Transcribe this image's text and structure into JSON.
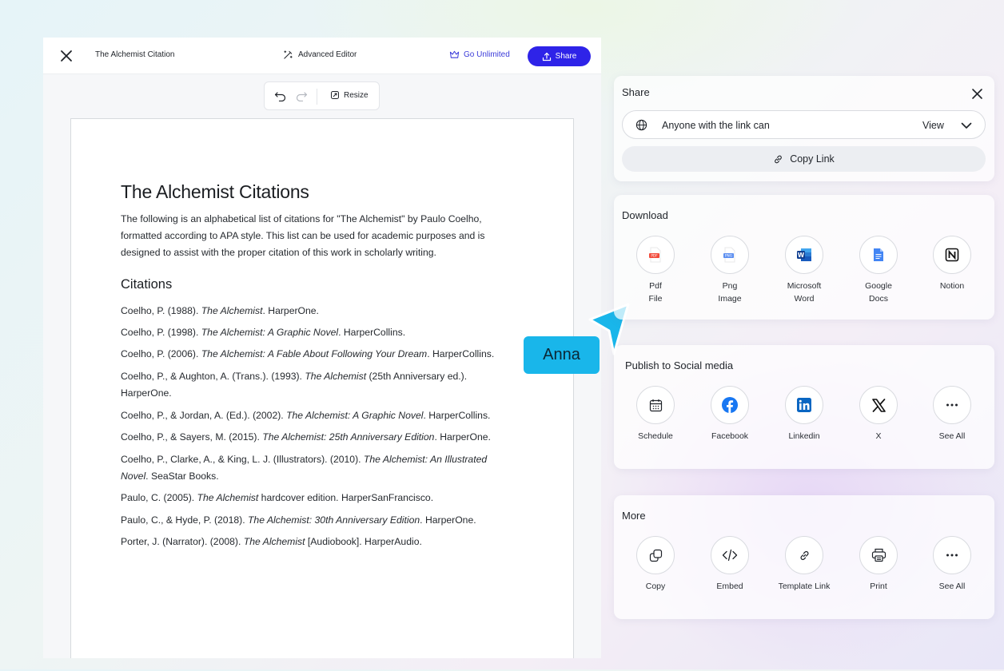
{
  "editor": {
    "doc_title": "The Alchemist Citation",
    "advanced_editor": "Advanced Editor",
    "go_unlimited": "Go Unlimited",
    "share": "Share",
    "resize": "Resize"
  },
  "document": {
    "heading": "The Alchemist Citations",
    "intro_lines": [
      "The following is an alphabetical list of citations for \"The Alchemist\" by Paulo Coelho,",
      "formatted according to APA style. This list can be used for academic purposes and is",
      "designed to assist with the proper citation of this work in scholarly writing."
    ],
    "citations_heading": "Citations",
    "citations": [
      [
        {
          "t": "Coelho, P. (1988). "
        },
        {
          "t": "The Alchemist",
          "i": true
        },
        {
          "t": ". HarperOne."
        }
      ],
      [
        {
          "t": "Coelho, P. (1998). "
        },
        {
          "t": "The Alchemist: A Graphic Novel",
          "i": true
        },
        {
          "t": ". HarperCollins."
        }
      ],
      [
        {
          "t": "Coelho, P. (2006). "
        },
        {
          "t": "The Alchemist: A Fable About Following Your Dream",
          "i": true
        },
        {
          "t": ". HarperCollins."
        }
      ],
      [
        {
          "t": "Coelho, P., & Aughton, A. (Trans.). (1993). "
        },
        {
          "t": "The Alchemist",
          "i": true
        },
        {
          "t": " (25th Anniversary ed.)."
        },
        {
          "br": true
        },
        {
          "t": "HarperOne."
        }
      ],
      [
        {
          "t": "Coelho, P., & Jordan, A. (Ed.). (2002). "
        },
        {
          "t": "The Alchemist: A Graphic Novel",
          "i": true
        },
        {
          "t": ". HarperCollins."
        }
      ],
      [
        {
          "t": "Coelho, P., & Sayers, M. (2015). "
        },
        {
          "t": "The Alchemist: 25th Anniversary Edition",
          "i": true
        },
        {
          "t": ". HarperOne."
        }
      ],
      [
        {
          "t": "Coelho, P., Clarke, A., & King, L. J. (Illustrators). (2010). "
        },
        {
          "t": "The Alchemist: An Illustrated",
          "i": true
        },
        {
          "br": true
        },
        {
          "t": "Novel",
          "i": true
        },
        {
          "t": ". SeaStar Books."
        }
      ],
      [
        {
          "t": "Paulo, C. (2005). "
        },
        {
          "t": "The Alchemist",
          "i": true
        },
        {
          "t": " hardcover edition. HarperSanFrancisco."
        }
      ],
      [
        {
          "t": "Paulo, C., & Hyde, P. (2018). "
        },
        {
          "t": "The Alchemist: 30th Anniversary Edition",
          "i": true
        },
        {
          "t": ". HarperOne."
        }
      ],
      [
        {
          "t": "Porter, J. (Narrator). (2008). "
        },
        {
          "t": "The Alchemist",
          "i": true
        },
        {
          "t": " [Audiobook]. HarperAudio."
        }
      ]
    ]
  },
  "cursor_tag": "Anna",
  "share_panel": {
    "title": "Share",
    "access_text": "Anyone with the link can",
    "access_value": "View",
    "copy_link": "Copy Link"
  },
  "download_panel": {
    "title": "Download",
    "items": [
      {
        "label": "Pdf\nFile",
        "icon": "pdf-file-icon"
      },
      {
        "label": "Png\nImage",
        "icon": "png-image-icon"
      },
      {
        "label": "Microsoft\nWord",
        "icon": "microsoft-word-icon"
      },
      {
        "label": "Google\nDocs",
        "icon": "google-docs-icon"
      },
      {
        "label": "Notion",
        "icon": "notion-icon"
      }
    ]
  },
  "social_panel": {
    "title": "Publish to Social media",
    "items": [
      {
        "label": "Schedule",
        "icon": "calendar-icon"
      },
      {
        "label": "Facebook",
        "icon": "facebook-icon"
      },
      {
        "label": "Linkedin",
        "icon": "linkedin-icon"
      },
      {
        "label": "X",
        "icon": "x-icon"
      },
      {
        "label": "See All",
        "icon": "more-icon"
      }
    ]
  },
  "more_panel": {
    "title": "More",
    "items": [
      {
        "label": "Copy",
        "icon": "copy-icon"
      },
      {
        "label": "Embed",
        "icon": "code-icon"
      },
      {
        "label": "Template Link",
        "icon": "link-icon"
      },
      {
        "label": "Print",
        "icon": "printer-icon"
      },
      {
        "label": "See All",
        "icon": "more-icon"
      }
    ]
  },
  "colors": {
    "accent": "#2e23e8",
    "cursor": "#19b6ea",
    "go_unlimited": "#3b3bd9"
  }
}
